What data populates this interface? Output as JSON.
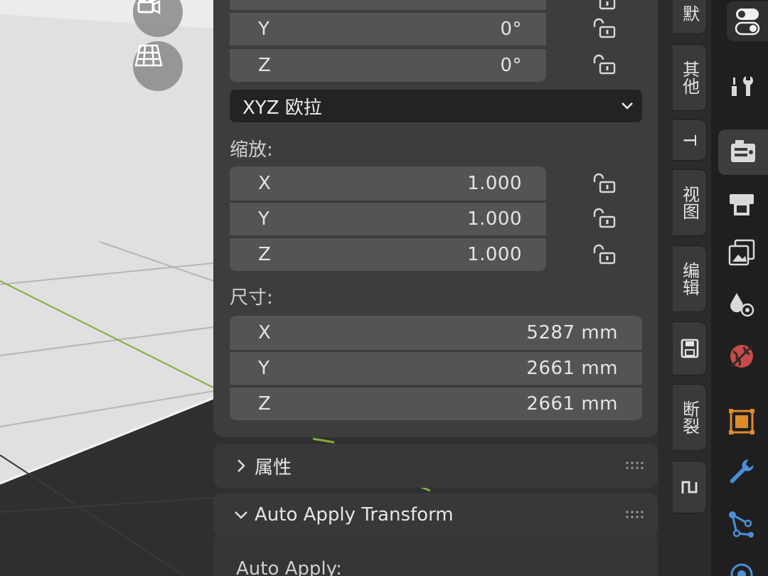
{
  "rotation": {
    "rows": [
      {
        "axis": "Y",
        "value": "0°"
      },
      {
        "axis": "Z",
        "value": "0°"
      }
    ],
    "mode": "XYZ 欧拉"
  },
  "scale": {
    "label": "缩放:",
    "rows": [
      {
        "axis": "X",
        "value": "1.000"
      },
      {
        "axis": "Y",
        "value": "1.000"
      },
      {
        "axis": "Z",
        "value": "1.000"
      }
    ]
  },
  "dimensions": {
    "label": "尺寸:",
    "rows": [
      {
        "axis": "X",
        "value": "5287 mm"
      },
      {
        "axis": "Y",
        "value": "2661 mm"
      },
      {
        "axis": "Z",
        "value": "2661 mm"
      }
    ]
  },
  "panels": {
    "properties_title": "属性",
    "auto_apply_title": "Auto Apply Transform",
    "auto_apply_label": "Auto Apply:"
  },
  "side_tabs": [
    "默",
    "其他",
    "T",
    "视图",
    "编辑",
    "",
    "断裂",
    ""
  ],
  "colors": {
    "panel_bg": "#3d3d3d",
    "field_bg": "#545454",
    "accent_orange": "#e08a2e",
    "accent_blue": "#4a8fd8",
    "viewport_light": "#e2e2e2"
  },
  "icons": {
    "props": [
      "toggle-icon",
      "tool-icon",
      "render-icon",
      "output-icon",
      "view-layer-icon",
      "scene-icon",
      "world-icon",
      "object-icon",
      "modifier-icon",
      "particles-icon",
      "physics-icon"
    ]
  }
}
